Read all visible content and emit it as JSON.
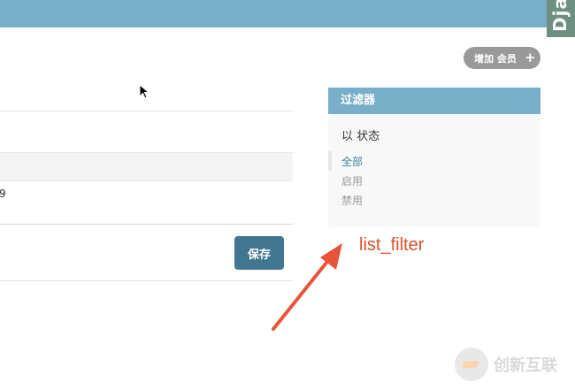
{
  "header": {
    "side_tab_label": "Djan"
  },
  "toolbar": {
    "add_member_label": "增加 会员",
    "add_icon": "plus-icon"
  },
  "table": {
    "partial_cell_text": "9"
  },
  "form": {
    "save_label": "保存"
  },
  "filter": {
    "title": "过滤器",
    "by_label": "以 状态",
    "options": [
      {
        "label": "全部",
        "selected": true
      },
      {
        "label": "启用",
        "selected": false
      },
      {
        "label": "禁用",
        "selected": false
      }
    ]
  },
  "annotation": {
    "label": "list_filter",
    "color": "#d9502a"
  },
  "watermark": {
    "text": "创新互联"
  },
  "colors": {
    "header": "#79aec8",
    "save_button": "#417690",
    "selected_filter": "#447e9b"
  }
}
